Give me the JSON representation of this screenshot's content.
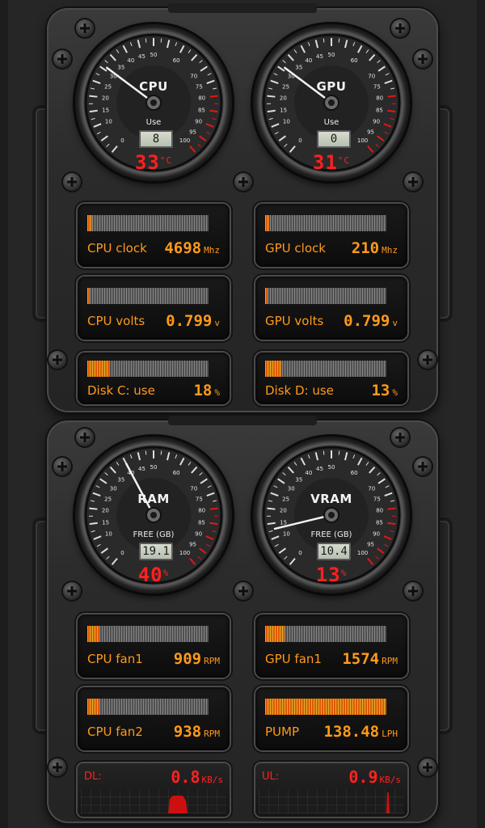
{
  "gauges": [
    {
      "key": "cpu",
      "title": "CPU",
      "sub": "Use",
      "lcd": "8",
      "temp": "33",
      "temp_unit": "°C",
      "needle": 31
    },
    {
      "key": "gpu",
      "title": "GPU",
      "sub": "Use",
      "lcd": "0",
      "temp": "31",
      "temp_unit": "°C",
      "needle": 31
    },
    {
      "key": "ram",
      "title": "RAM",
      "sub": "FREE (GB)",
      "lcd": "19.1",
      "temp": "40",
      "temp_unit": "%",
      "needle": 40
    },
    {
      "key": "vram",
      "title": "VRAM",
      "sub": "FREE (GB)",
      "lcd": "10.4",
      "temp": "13",
      "temp_unit": "%",
      "needle": 13
    }
  ],
  "gauge_scale": {
    "labels": [
      "0",
      "10",
      "15",
      "20",
      "25",
      "30",
      "35",
      "40",
      "45",
      "50",
      "60",
      "70",
      "75",
      "80",
      "85",
      "90",
      "95",
      "100"
    ]
  },
  "cards": [
    {
      "key": "cpu-clock",
      "label": "CPU clock",
      "value": "4698",
      "unit": "Mhz",
      "fill_pct": 4
    },
    {
      "key": "gpu-clock",
      "label": "GPU clock",
      "value": "210",
      "unit": "Mhz",
      "fill_pct": 3
    },
    {
      "key": "cpu-volts",
      "label": "CPU volts",
      "value": "0.799",
      "unit": "v",
      "fill_pct": 2
    },
    {
      "key": "gpu-volts",
      "label": "GPU volts",
      "value": "0.799",
      "unit": "v",
      "fill_pct": 2
    },
    {
      "key": "disk-c",
      "label": "Disk C: use",
      "value": "18",
      "unit": "%",
      "fill_pct": 18
    },
    {
      "key": "disk-d",
      "label": "Disk D: use",
      "value": "13",
      "unit": "%",
      "fill_pct": 13
    },
    {
      "key": "cpu-fan1",
      "label": "CPU fan1",
      "value": "909",
      "unit": "RPM",
      "fill_pct": 10
    },
    {
      "key": "gpu-fan1",
      "label": "GPU fan1",
      "value": "1574",
      "unit": "RPM",
      "fill_pct": 16
    },
    {
      "key": "cpu-fan2",
      "label": "CPU fan2",
      "value": "938",
      "unit": "RPM",
      "fill_pct": 10
    },
    {
      "key": "pump",
      "label": "PUMP",
      "value": "138.48",
      "unit": "LPH",
      "fill_pct": 100
    }
  ],
  "network": [
    {
      "key": "dl",
      "label": "DL:",
      "value": "0.8",
      "unit": "KB/s"
    },
    {
      "key": "ul",
      "label": "UL:",
      "value": "0.9",
      "unit": "KB/s"
    }
  ],
  "colors": {
    "accent": "#ff9a1a",
    "alert": "#ff2020",
    "bar_fill": "#ff6600"
  }
}
